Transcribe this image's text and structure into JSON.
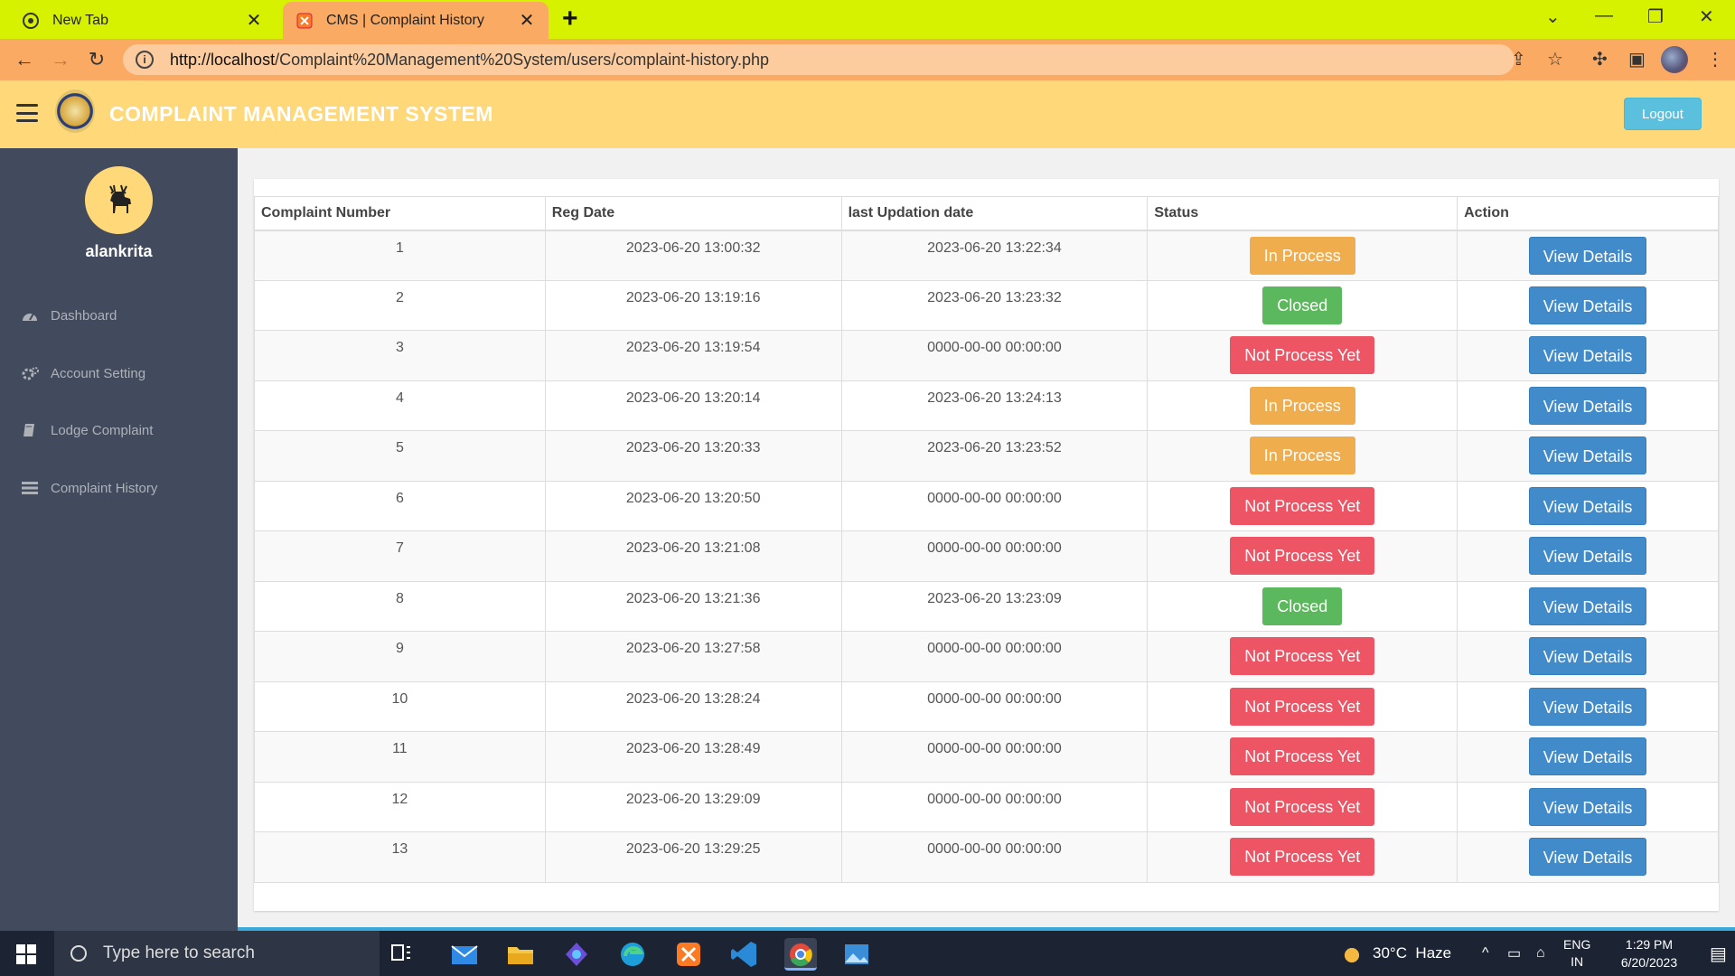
{
  "browser": {
    "tabs": [
      {
        "title": "New Tab",
        "active": false
      },
      {
        "title": "CMS | Complaint History",
        "active": true
      }
    ],
    "url_host": "http://localhost",
    "url_path": "/Complaint%20Management%20System/users/complaint-history.php"
  },
  "header": {
    "title": "COMPLAINT MANAGEMENT SYSTEM",
    "logout_label": "Logout"
  },
  "sidebar": {
    "username": "alankrita",
    "items": [
      {
        "label": "Dashboard",
        "icon": "dashboard-icon"
      },
      {
        "label": "Account Setting",
        "icon": "cogs-icon"
      },
      {
        "label": "Lodge Complaint",
        "icon": "book-icon"
      },
      {
        "label": "Complaint History",
        "icon": "list-icon"
      }
    ]
  },
  "table": {
    "headers": [
      "Complaint Number",
      "Reg Date",
      "last Updation date",
      "Status",
      "Action"
    ],
    "action_label": "View Details",
    "rows": [
      {
        "num": "1",
        "reg": "2023-06-20 13:00:32",
        "upd": "2023-06-20 13:22:34",
        "status": "In Process"
      },
      {
        "num": "2",
        "reg": "2023-06-20 13:19:16",
        "upd": "2023-06-20 13:23:32",
        "status": "Closed"
      },
      {
        "num": "3",
        "reg": "2023-06-20 13:19:54",
        "upd": "0000-00-00 00:00:00",
        "status": "Not Process Yet"
      },
      {
        "num": "4",
        "reg": "2023-06-20 13:20:14",
        "upd": "2023-06-20 13:24:13",
        "status": "In Process"
      },
      {
        "num": "5",
        "reg": "2023-06-20 13:20:33",
        "upd": "2023-06-20 13:23:52",
        "status": "In Process"
      },
      {
        "num": "6",
        "reg": "2023-06-20 13:20:50",
        "upd": "0000-00-00 00:00:00",
        "status": "Not Process Yet"
      },
      {
        "num": "7",
        "reg": "2023-06-20 13:21:08",
        "upd": "0000-00-00 00:00:00",
        "status": "Not Process Yet"
      },
      {
        "num": "8",
        "reg": "2023-06-20 13:21:36",
        "upd": "2023-06-20 13:23:09",
        "status": "Closed"
      },
      {
        "num": "9",
        "reg": "2023-06-20 13:27:58",
        "upd": "0000-00-00 00:00:00",
        "status": "Not Process Yet"
      },
      {
        "num": "10",
        "reg": "2023-06-20 13:28:24",
        "upd": "0000-00-00 00:00:00",
        "status": "Not Process Yet"
      },
      {
        "num": "11",
        "reg": "2023-06-20 13:28:49",
        "upd": "0000-00-00 00:00:00",
        "status": "Not Process Yet"
      },
      {
        "num": "12",
        "reg": "2023-06-20 13:29:09",
        "upd": "0000-00-00 00:00:00",
        "status": "Not Process Yet"
      },
      {
        "num": "13",
        "reg": "2023-06-20 13:29:25",
        "upd": "0000-00-00 00:00:00",
        "status": "Not Process Yet"
      }
    ]
  },
  "taskbar": {
    "search_placeholder": "Type here to search",
    "weather": "30°C  Haze",
    "lang_line1": "ENG",
    "lang_line2": "IN",
    "time": "1:29 PM",
    "date": "6/20/2023"
  },
  "colors": {
    "in_process": "#f0ad4e",
    "closed": "#5cb85c",
    "not_process_yet": "#ed5565",
    "view_button": "#428bca",
    "header_bg": "#ffd87a",
    "sidebar_bg": "#424a5d"
  }
}
